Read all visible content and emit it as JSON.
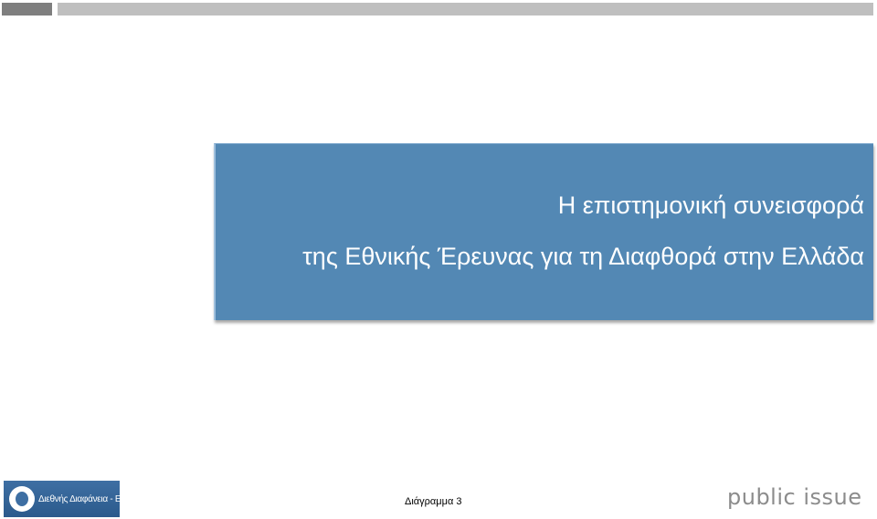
{
  "slide": {
    "title_line1": "Η επιστημονική συνεισφορά",
    "title_line2": "της Εθνικής Έρευνας για τη Διαφθορά στην Ελλάδα",
    "footer_label": "Διάγραμμα 3"
  },
  "logos": {
    "transparency": "Διεθνής Διαφάνεια - Ελλάς",
    "public_issue": "public issue"
  },
  "colors": {
    "title_box": "#5388b4",
    "header_bar_dark": "#7f7f7f",
    "header_bar_light": "#bfbfbf",
    "title_text": "#ffffff"
  }
}
